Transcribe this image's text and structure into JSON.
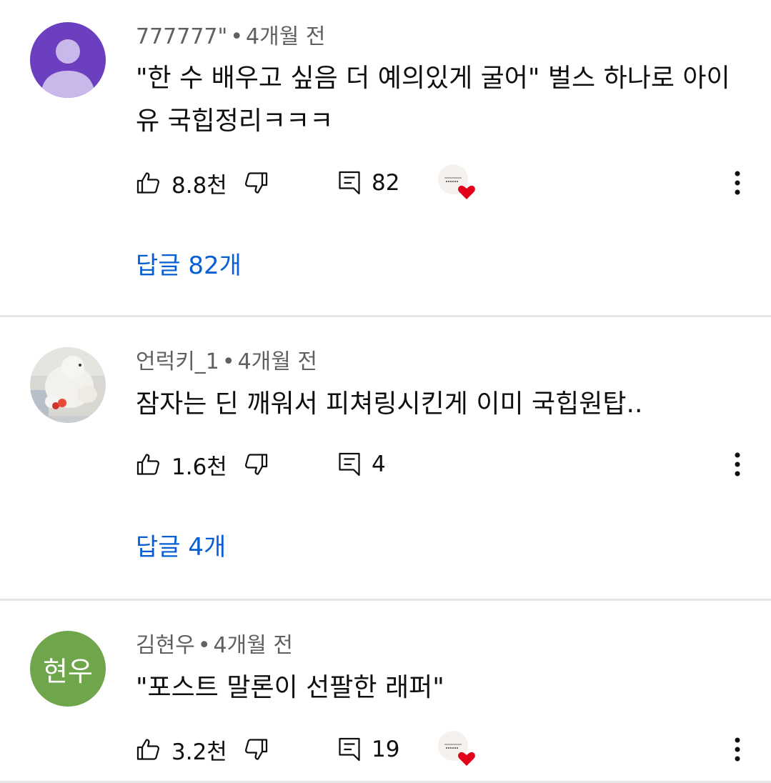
{
  "comments": [
    {
      "author": "777777\"",
      "time": "4개월 전",
      "text": "\"한 수 배우고 싶음 더 예의있게 굴어\" 벌스 하나로 아이유 국힙정리ㅋㅋㅋ",
      "likes": "8.8천",
      "reply_count": "82",
      "replies_label": "답글 82개",
      "creator_heart": true,
      "avatar": {
        "type": "default-person",
        "color": "#6b3fbf"
      }
    },
    {
      "author": "언럭키_1",
      "time": "4개월 전",
      "text": "잠자는 딘 깨워서 피쳐링시킨게 이미 국힙원탑..",
      "likes": "1.6천",
      "reply_count": "4",
      "replies_label": "답글 4개",
      "creator_heart": false,
      "avatar": {
        "type": "photo-plush-bear"
      }
    },
    {
      "author": "김현우",
      "time": "4개월 전",
      "text": "\"포스트 말론이 선팔한 래퍼\"",
      "likes": "3.2천",
      "reply_count": "19",
      "creator_heart": true,
      "avatar": {
        "type": "initials",
        "initials": "현우",
        "color": "#6fa64b"
      }
    }
  ],
  "colors": {
    "link": "#065fd4",
    "secondary_text": "#606060",
    "divider": "#e5e5e5",
    "heart": "#e3001b"
  },
  "icons": [
    "like-icon",
    "dislike-icon",
    "reply-icon",
    "creator-heart-icon",
    "more-vert-icon",
    "default-avatar-icon"
  ]
}
